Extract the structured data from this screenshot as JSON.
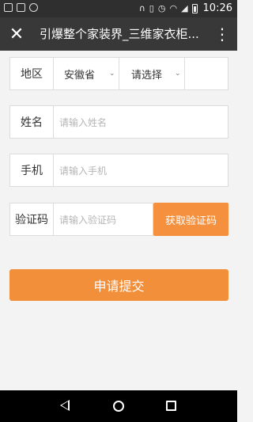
{
  "status_bar": {
    "time": "10:26",
    "left_icons": [
      "image-icon",
      "inbox-icon",
      "settings-circle-icon"
    ],
    "right_icons": [
      "headset-icon",
      "vibrate-icon",
      "alarm-icon",
      "wifi-icon",
      "signal-icon",
      "battery-icon"
    ]
  },
  "header": {
    "close_glyph": "✕",
    "title": "引爆整个家装界_三维家衣柜...",
    "more_glyph": "⋮"
  },
  "form": {
    "region": {
      "label": "地区",
      "province_value": "安徽省",
      "city_value": "请选择"
    },
    "name": {
      "label": "姓名",
      "placeholder": "请输入姓名"
    },
    "phone": {
      "label": "手机",
      "placeholder": "请输入手机"
    },
    "code": {
      "label": "验证码",
      "placeholder": "请输入验证码",
      "button": "获取验证码"
    },
    "submit": "申请提交"
  },
  "colors": {
    "accent": "#f28f3a",
    "titlebar": "#383838",
    "statusbar": "#2f2f2f"
  }
}
